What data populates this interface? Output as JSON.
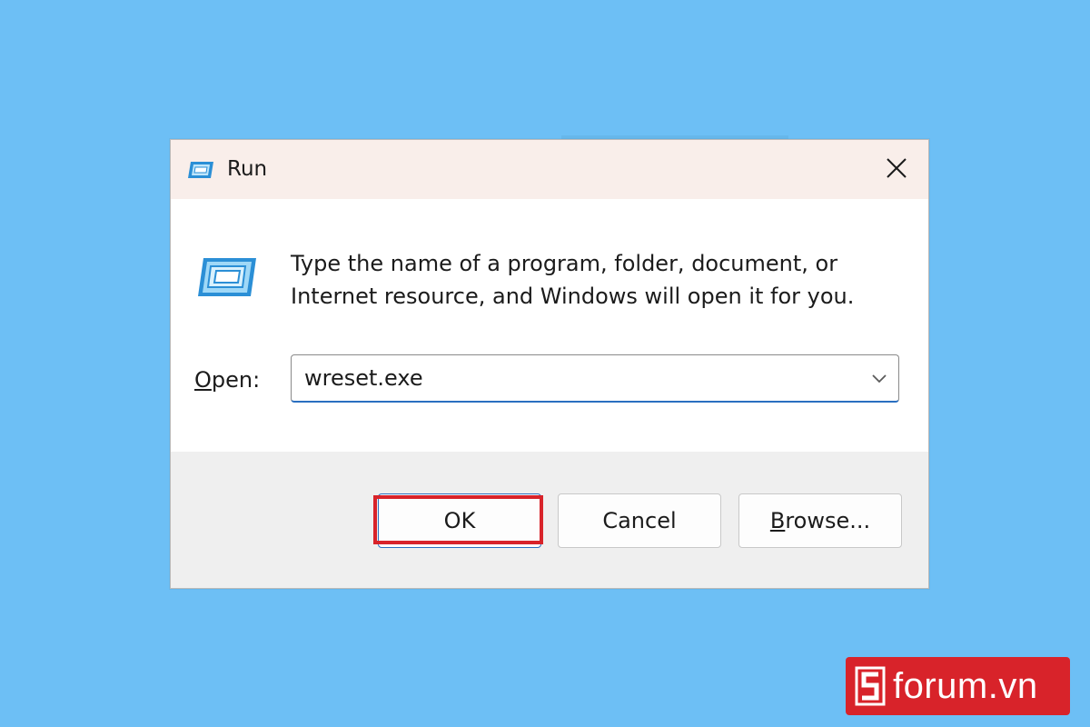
{
  "window": {
    "title": "Run",
    "title_icon": "run-icon",
    "close_icon": "close-icon"
  },
  "body": {
    "icon": "run-icon",
    "prompt": "Type the name of a program, folder, document, or Internet resource, and Windows will open it for you.",
    "open_label_first": "O",
    "open_label_rest": "pen:",
    "open_value": "wreset.exe",
    "dropdown_icon": "chevron-down-icon"
  },
  "buttons": {
    "ok": "OK",
    "cancel": "Cancel",
    "browse_first": "B",
    "browse_rest": "rowse..."
  },
  "annotation": {
    "highlight_color": "#d8232a"
  },
  "watermark": {
    "text": "forum.vn",
    "logo_letter": "S"
  },
  "colors": {
    "background": "#6dbff5",
    "titlebar": "#f9eeea",
    "footer": "#efefef",
    "accent": "#2a6fc0",
    "brand_red": "#d8232a"
  }
}
